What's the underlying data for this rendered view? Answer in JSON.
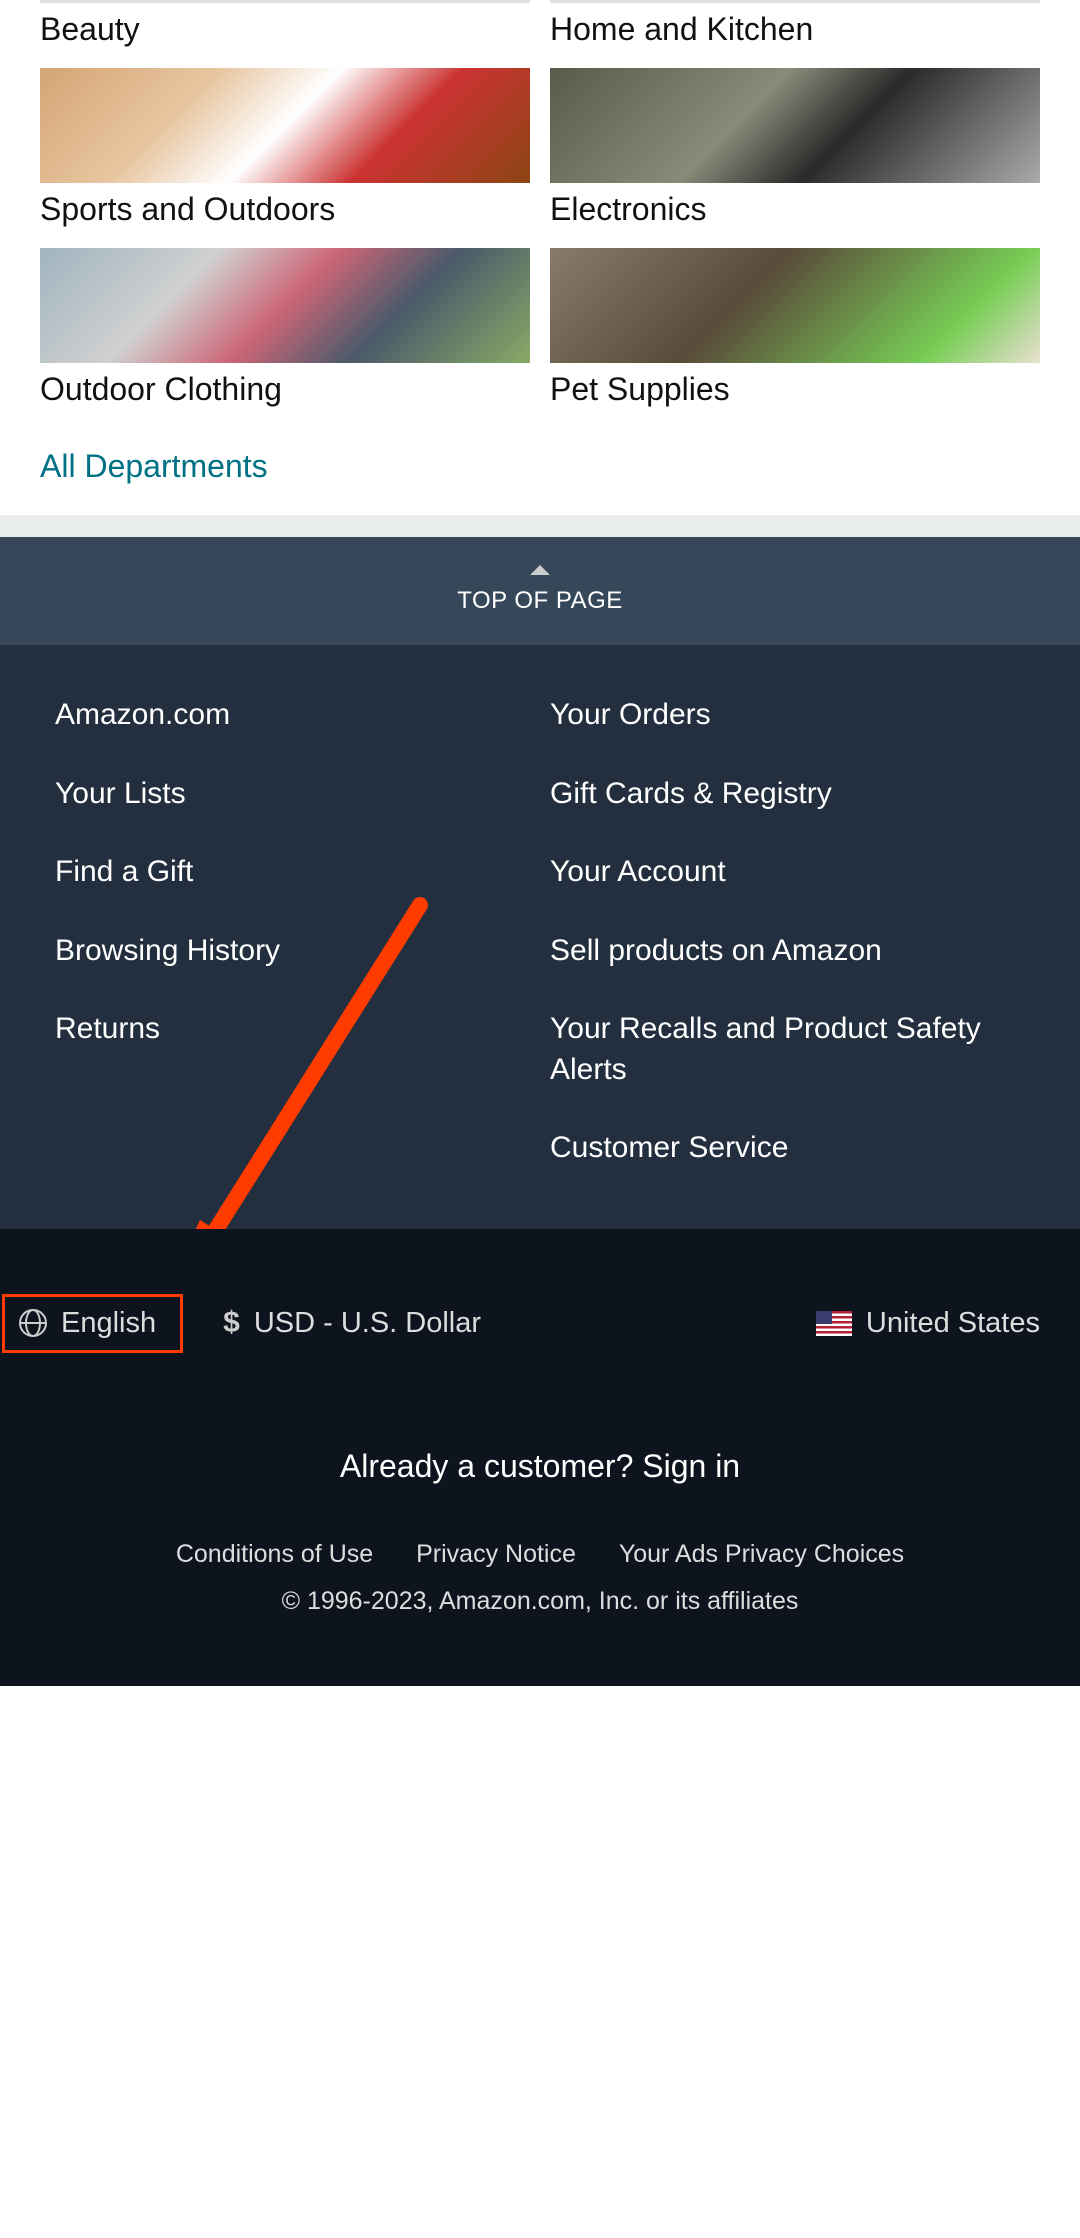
{
  "departments": {
    "row1": [
      {
        "label": "Beauty"
      },
      {
        "label": "Home and Kitchen"
      }
    ],
    "row2": [
      {
        "label": "Sports and Outdoors"
      },
      {
        "label": "Electronics"
      }
    ],
    "row3": [
      {
        "label": "Outdoor Clothing"
      },
      {
        "label": "Pet Supplies"
      }
    ],
    "all_link": "All Departments"
  },
  "top_of_page": "TOP OF PAGE",
  "footer_links": {
    "left": [
      "Amazon.com",
      "Your Lists",
      "Find a Gift",
      "Browsing History",
      "Returns"
    ],
    "right": [
      "Your Orders",
      "Gift Cards & Registry",
      "Your Account",
      "Sell products on Amazon",
      "Your Recalls and Product Safety Alerts",
      "Customer Service"
    ]
  },
  "locale": {
    "language": "English",
    "currency": "USD - U.S. Dollar",
    "country": "United States"
  },
  "signin": {
    "prompt": "Already a customer?",
    "action": "Sign in"
  },
  "legal": {
    "conditions": "Conditions of Use",
    "privacy": "Privacy Notice",
    "ads": "Your Ads Privacy Choices"
  },
  "copyright": "© 1996-2023, Amazon.com, Inc. or its affiliates",
  "annotation": {
    "arrow_color": "#ff3b00",
    "highlight_color": "#ff3b00"
  }
}
